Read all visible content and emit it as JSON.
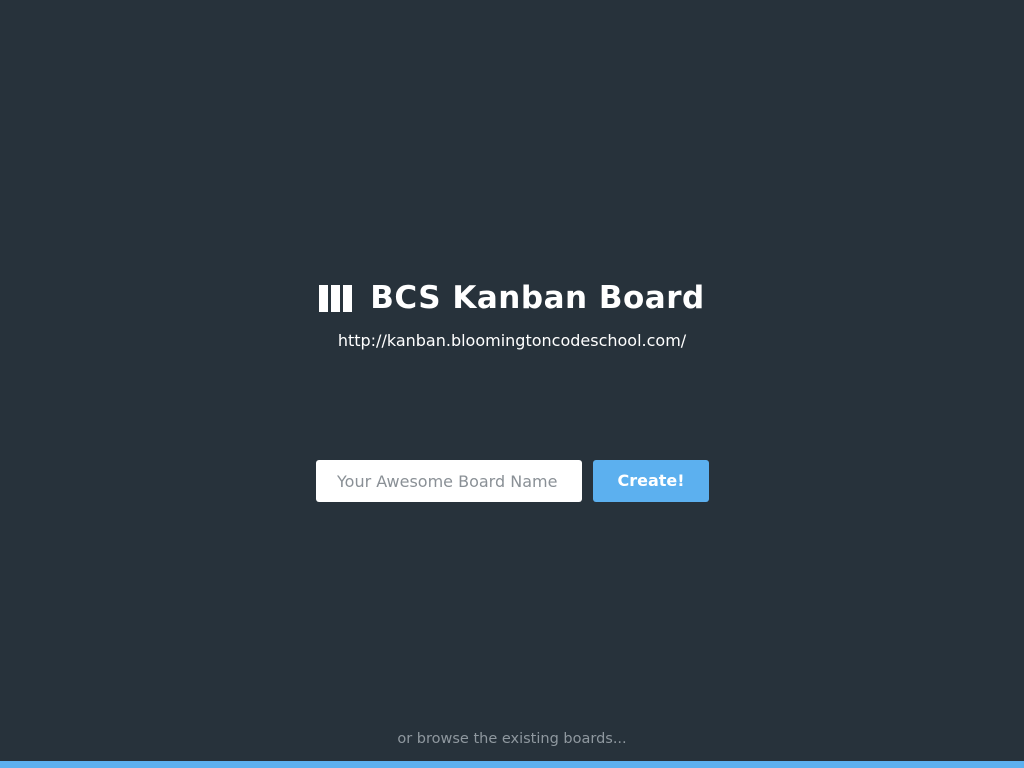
{
  "header": {
    "logo_icon": "kanban-columns-icon",
    "title": "BCS Kanban Board",
    "url": "http://kanban.bloomingtoncodeschool.com/"
  },
  "form": {
    "board_name_placeholder": "Your Awesome Board Name",
    "board_name_value": "",
    "create_label": "Create!"
  },
  "footer": {
    "browse_label": "or browse the existing boards..."
  },
  "colors": {
    "background": "#27323b",
    "accent": "#5cb0ef",
    "muted_text": "#8f989f"
  }
}
